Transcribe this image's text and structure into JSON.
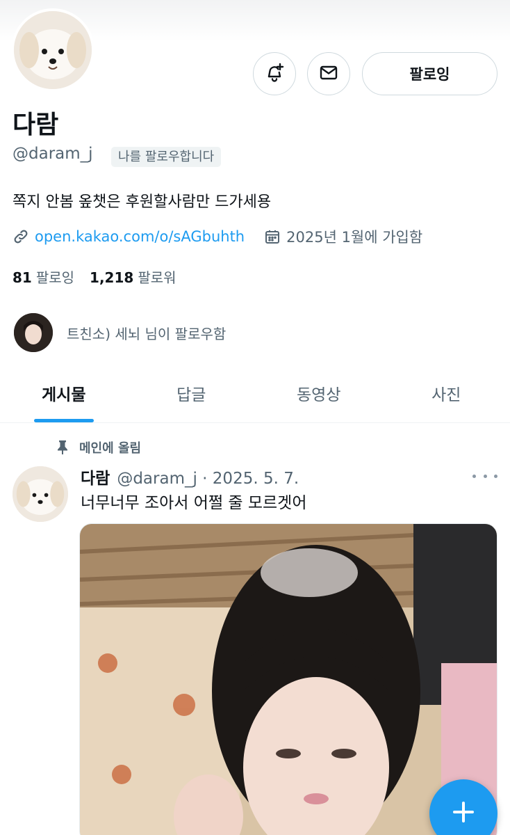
{
  "profile": {
    "name": "다람",
    "handle": "@daram_j",
    "follows_you": "나를 팔로우합니다",
    "bio": "쪽지 안봄 옾챗은 후원할사람만 드가세용",
    "link": "open.kakao.com/o/sAGbuhth",
    "joined": "2025년 1월에 가입함",
    "following_count": "81",
    "following_label": "팔로잉",
    "followers_count": "1,218",
    "followers_label": "팔로워",
    "followed_by": "트친소) 세뇌 님이 팔로우함"
  },
  "actions": {
    "notify_icon": "bell-plus-icon",
    "message_icon": "envelope-icon",
    "follow_label": "팔로잉"
  },
  "tabs": [
    {
      "label": "게시물",
      "active": true
    },
    {
      "label": "답글",
      "active": false
    },
    {
      "label": "동영상",
      "active": false
    },
    {
      "label": "사진",
      "active": false
    }
  ],
  "post": {
    "pinned_label": "메인에 올림",
    "name": "다람",
    "handle_date": "@daram_j · 2025. 5. 7.",
    "text": "너무너무 조아서 어쩔 줄 모르겟어"
  },
  "colors": {
    "accent": "#1d9bf0",
    "secondary_text": "#536471",
    "primary_text": "#0f1419"
  }
}
